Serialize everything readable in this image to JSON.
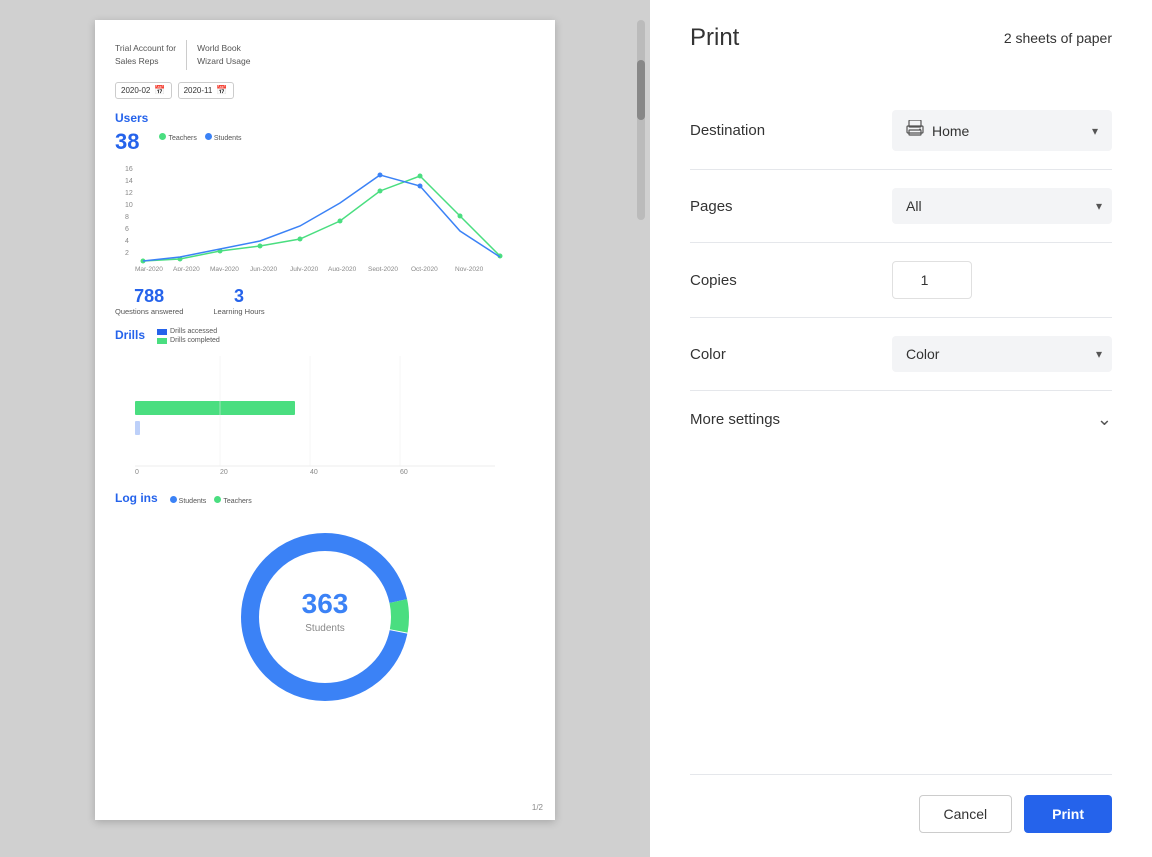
{
  "header": {
    "title": "Print",
    "sheets": "2 sheets of paper"
  },
  "preview": {
    "title_left_line1": "Trial Account for",
    "title_left_line2": "Sales Reps",
    "title_right_line1": "World Book",
    "title_right_line2": "Wizard Usage",
    "date_from": "2020-02",
    "date_to": "2020-11",
    "page_number": "1/2",
    "users_count": "38",
    "users_section_title": "Users",
    "questions_answered": "788",
    "questions_label": "Questions answered",
    "learning_hours": "3",
    "learning_label": "Learning Hours",
    "drills_title": "Drills",
    "logins_title": "Log ins",
    "logins_count": "363",
    "logins_sublabel": "Students"
  },
  "settings": {
    "destination_label": "Destination",
    "destination_value": "Home",
    "pages_label": "Pages",
    "pages_value": "All",
    "copies_label": "Copies",
    "copies_value": "1",
    "color_label": "Color",
    "color_value": "Color",
    "more_settings_label": "More settings"
  },
  "actions": {
    "cancel_label": "Cancel",
    "print_label": "Print"
  },
  "legend": {
    "teachers_color": "#4ade80",
    "students_color": "#3b82f6",
    "drills_accessed_color": "#2563eb",
    "drills_completed_color": "#4ade80"
  }
}
